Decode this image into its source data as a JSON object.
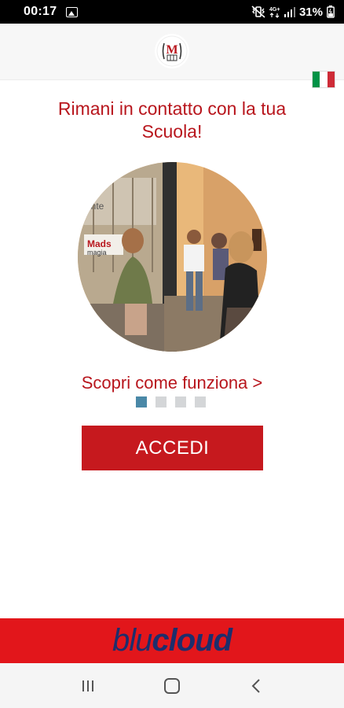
{
  "status_bar": {
    "time": "00:17",
    "network": "4G+",
    "battery": "31%"
  },
  "app": {
    "logo_letter": "M",
    "language_flag": "italian-flag-icon"
  },
  "main": {
    "headline": "Rimani in contatto con la tua Scuola!",
    "discover_link": "Scopri come funziona >",
    "carousel": {
      "total": 4,
      "active_index": 0
    },
    "login_button": "ACCEDI"
  },
  "footer": {
    "brand_a": "blu",
    "brand_b": "cloud"
  },
  "colors": {
    "accent_red": "#c6191e",
    "brand_bar_red": "#e2161b",
    "brand_navy": "#1d2e6c",
    "dot_active": "#4a88a7",
    "dot_inactive": "#d4d6d8"
  },
  "nav": {
    "icons": [
      "recent-apps-icon",
      "home-icon",
      "back-icon"
    ]
  }
}
